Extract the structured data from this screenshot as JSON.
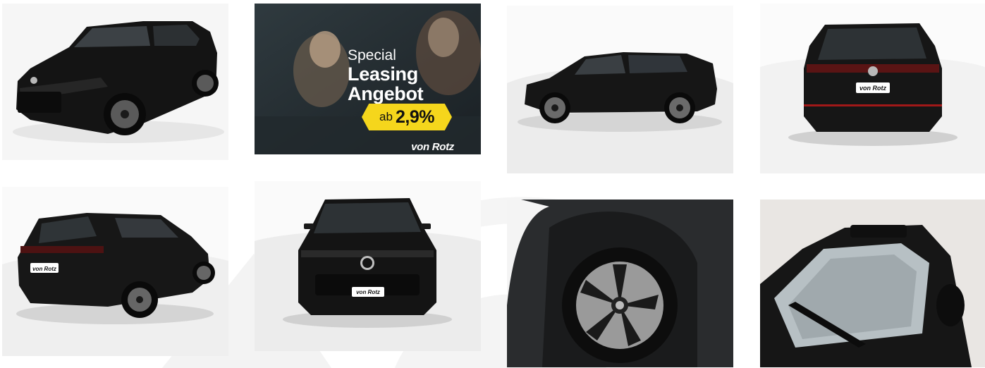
{
  "gallery": {
    "promo": {
      "special": "Special",
      "line1": "Leasing",
      "line2": "Angebot",
      "rate_prefix": "ab",
      "rate_value": "2,9%",
      "brand": "von Rotz"
    },
    "plate_text": "von Rotz",
    "badge_color": "#f5d61c"
  }
}
